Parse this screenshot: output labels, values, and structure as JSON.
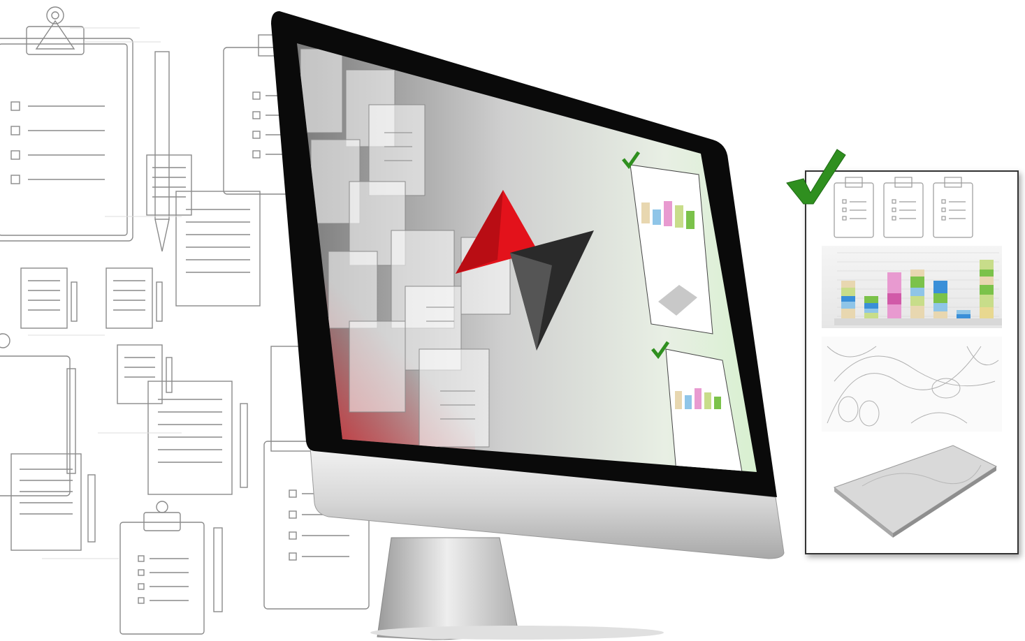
{
  "scene": {
    "background_color": "#ffffff",
    "accent_red": "#e3121b",
    "accent_dark": "#2a2a2a",
    "check_green": "#2f8f1f"
  },
  "icons": {
    "clipboard": "clipboard-icon",
    "document": "document-icon",
    "pencil": "pencil-icon",
    "check": "checkmark-icon",
    "logo": "arrow-logo-icon"
  },
  "report_chart": {
    "type": "bar",
    "stacked": true,
    "num_bars": 7,
    "colors": [
      "#e8d7b0",
      "#8fc5e8",
      "#3a8fd8",
      "#c8dd8a",
      "#7bc24a",
      "#e89ad0",
      "#d15aa8",
      "#e8d890"
    ]
  }
}
